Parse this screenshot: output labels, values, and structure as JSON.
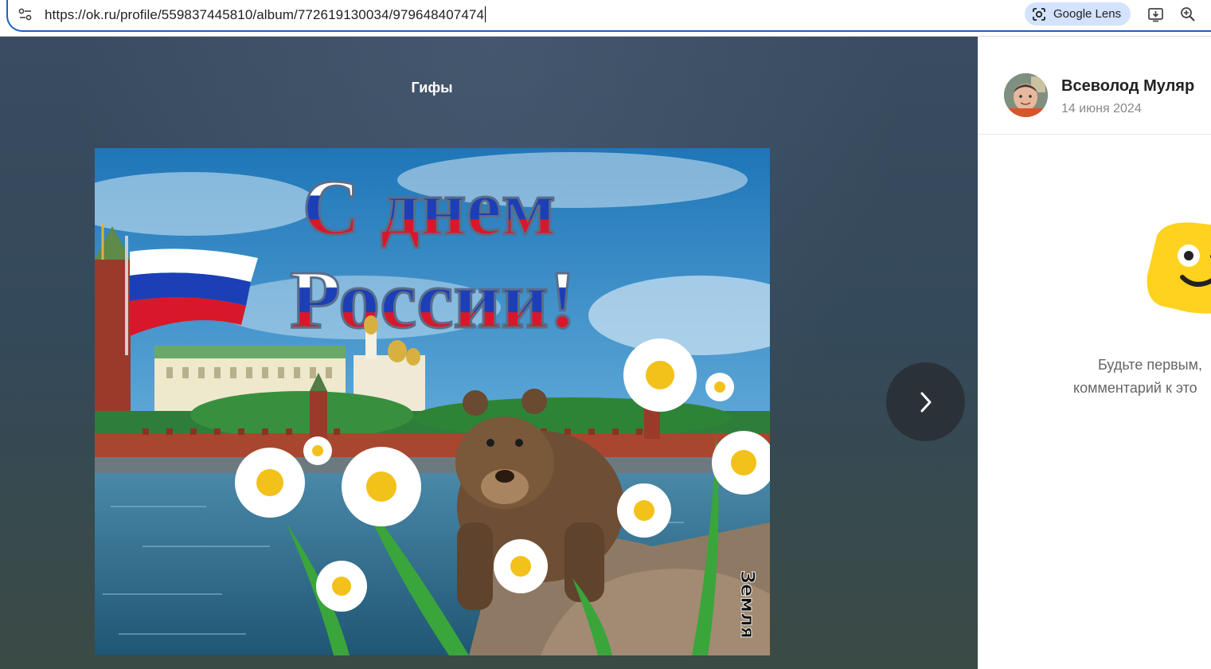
{
  "browser": {
    "url": "https://ok.ru/profile/559837445810/album/772619130034/979648407474",
    "lens_label": "Google Lens"
  },
  "viewer": {
    "album_title": "Гифы",
    "photo": {
      "greeting_line1": "С днем",
      "greeting_line2": "России!",
      "watermark": "Земля"
    }
  },
  "post": {
    "author_name": "Всеволод Муляр",
    "date": "14 июня 2024"
  },
  "comments": {
    "empty_line1": "Будьте первым,",
    "empty_line2": "комментарий к это"
  },
  "colors": {
    "omnibox_border": "#1f5fbf",
    "lens_chip": "#d3e3fd",
    "flag_white": "#ffffff",
    "flag_blue": "#1c3fb8",
    "flag_red": "#d8182a",
    "mascot_yellow": "#ffd21f"
  }
}
